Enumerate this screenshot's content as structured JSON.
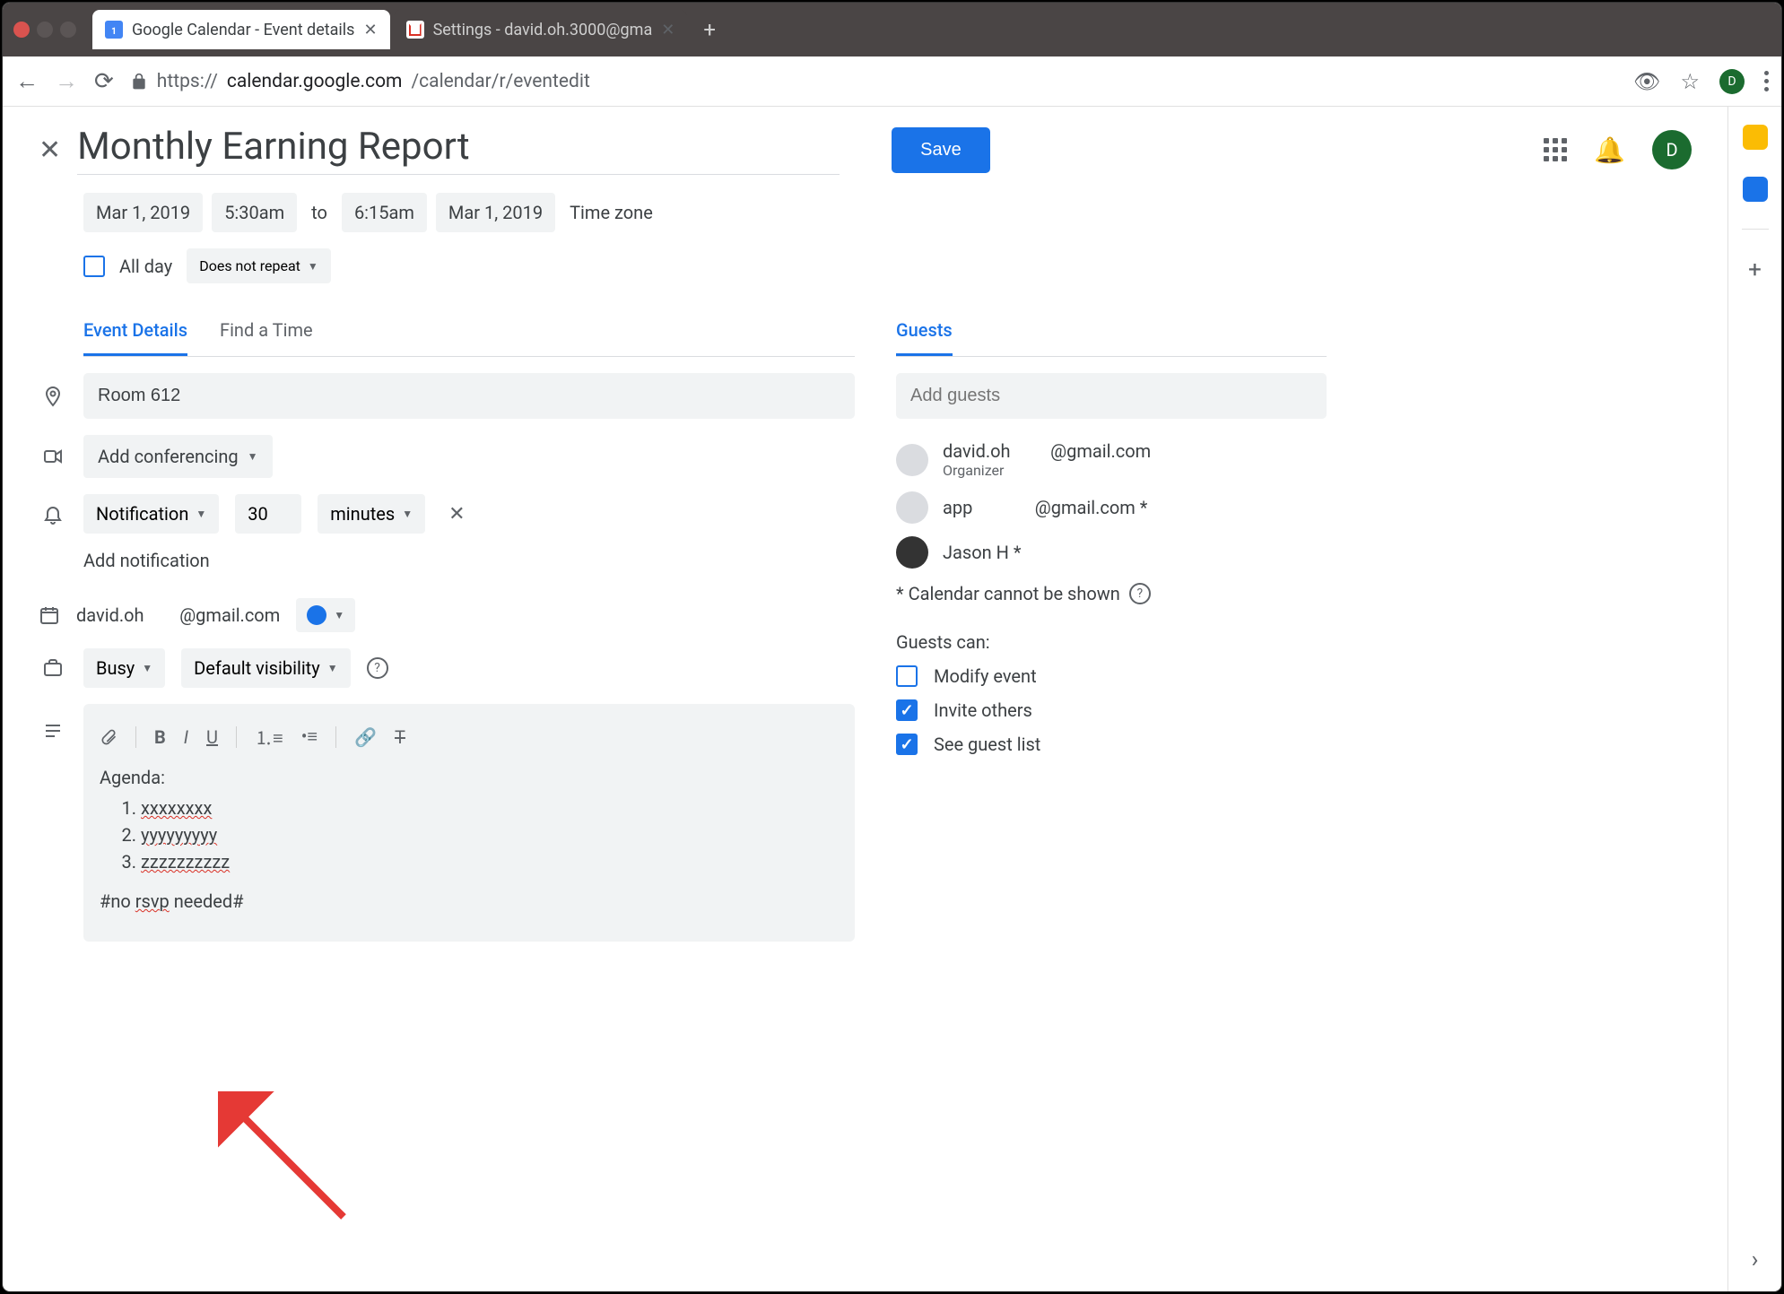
{
  "browser": {
    "tabs": [
      {
        "title": "Google Calendar - Event details"
      },
      {
        "title": "Settings - david.oh.3000@gma"
      }
    ],
    "url_prefix": "https://",
    "url_domain": "calendar.google.com",
    "url_path": "/calendar/r/eventedit",
    "avatar_initial": "D"
  },
  "header": {
    "event_title": "Monthly Earning Report",
    "save_label": "Save",
    "avatar_initial": "D"
  },
  "datetime": {
    "start_date": "Mar 1, 2019",
    "start_time": "5:30am",
    "to_label": "to",
    "end_time": "6:15am",
    "end_date": "Mar 1, 2019",
    "timezone_label": "Time zone",
    "all_day_label": "All day",
    "repeat_label": "Does not repeat"
  },
  "tabs": {
    "event_details": "Event Details",
    "find_time": "Find a Time",
    "guests": "Guests"
  },
  "details": {
    "location": "Room 612",
    "conferencing_label": "Add conferencing",
    "notification_type": "Notification",
    "notification_value": "30",
    "notification_unit": "minutes",
    "add_notification_label": "Add notification",
    "owner_email": "david.oh        @gmail.com",
    "busy_label": "Busy",
    "visibility_label": "Default visibility"
  },
  "description": {
    "heading": "Agenda:",
    "items": [
      "xxxxxxxx",
      "yyyyyyyyy",
      "zzzzzzzzzz"
    ],
    "footer": "#no rsvp needed#"
  },
  "guests": {
    "add_placeholder": "Add guests",
    "list": [
      {
        "email": "david.oh         @gmail.com",
        "sub": "Organizer"
      },
      {
        "email": "app              @gmail.com *",
        "sub": ""
      },
      {
        "email": "Jason H *",
        "sub": ""
      }
    ],
    "note": "* Calendar cannot be shown",
    "perms_title": "Guests can:",
    "perms": [
      {
        "label": "Modify event",
        "checked": false
      },
      {
        "label": "Invite others",
        "checked": true
      },
      {
        "label": "See guest list",
        "checked": true
      }
    ]
  }
}
